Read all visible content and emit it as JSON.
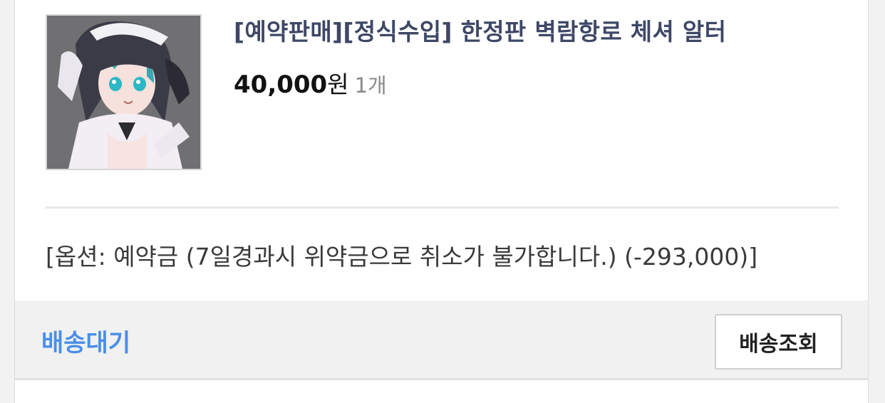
{
  "product": {
    "title": "[예약판매][정식수입] 한정판 벽람항로 체셔 알터",
    "price": "40,000",
    "currency": "원",
    "quantity": "1개",
    "option": "[옵션: 예약금 (7일경과시 위약금으로 취소가 불가합니다.) (-293,000)]"
  },
  "order": {
    "status": "배송대기",
    "track_button_label": "배송조회"
  },
  "colors": {
    "status_blue": "#4a8ee8",
    "title_navy": "#3e4766"
  }
}
